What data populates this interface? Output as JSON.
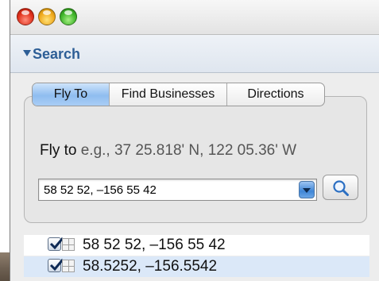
{
  "search_panel": {
    "title": "Search",
    "tabs": [
      {
        "label": "Fly To",
        "active": true
      },
      {
        "label": "Find Businesses",
        "active": false
      },
      {
        "label": "Directions",
        "active": false
      }
    ],
    "fly_to_label": "Fly to",
    "fly_to_hint": "e.g., 37 25.818' N, 122 05.36' W",
    "input_value": "58 52 52, –156 55 42",
    "search_icon": "magnifier-icon"
  },
  "results": [
    {
      "text": "58 52 52, –156 55 42",
      "checked": true,
      "selected": false
    },
    {
      "text": "58.5252, –156.5542",
      "checked": true,
      "selected": true
    }
  ],
  "colors": {
    "accent": "#2d5e96",
    "active_tab": "#8fbdf0",
    "selected_row": "#dbe8f8"
  }
}
